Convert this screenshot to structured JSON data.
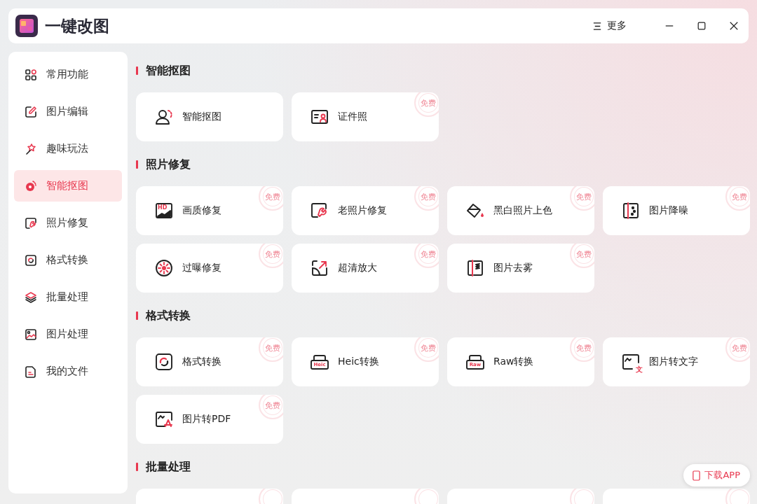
{
  "app": {
    "title": "一键改图",
    "more": "更多"
  },
  "sidebar": [
    {
      "label": "常用功能",
      "selected": false
    },
    {
      "label": "图片编辑",
      "selected": false
    },
    {
      "label": "趣味玩法",
      "selected": false
    },
    {
      "label": "智能抠图",
      "selected": true
    },
    {
      "label": "照片修复",
      "selected": false
    },
    {
      "label": "格式转换",
      "selected": false
    },
    {
      "label": "批量处理",
      "selected": false
    },
    {
      "label": "图片处理",
      "selected": false
    },
    {
      "label": "我的文件",
      "selected": false
    }
  ],
  "sections": [
    {
      "title": "智能抠图",
      "cards": [
        {
          "label": "智能抠图"
        },
        {
          "label": "证件照",
          "badge": "免费"
        }
      ]
    },
    {
      "title": "照片修复",
      "cards": [
        {
          "label": "画质修复",
          "badge": "免费",
          "tag": "HD"
        },
        {
          "label": "老照片修复",
          "badge": "免费"
        },
        {
          "label": "黑白照片上色",
          "badge": "免费"
        },
        {
          "label": "图片降噪",
          "badge": "免费"
        },
        {
          "label": "过曝修复",
          "badge": "免费"
        },
        {
          "label": "超清放大",
          "badge": "免费"
        },
        {
          "label": "图片去雾",
          "badge": "免费"
        }
      ]
    },
    {
      "title": "格式转换",
      "cards": [
        {
          "label": "格式转换",
          "badge": "免费"
        },
        {
          "label": "Heic转换",
          "badge": "免费",
          "tag": "Heic"
        },
        {
          "label": "Raw转换",
          "badge": "免费",
          "tag": "Raw"
        },
        {
          "label": "图片转文字",
          "badge": "免费",
          "tag": "文"
        },
        {
          "label": "图片转PDF",
          "badge": "免费"
        }
      ]
    },
    {
      "title": "批量处理",
      "cards": [
        {
          "stamp": true
        },
        {
          "stamp": true
        },
        {
          "stamp": true
        },
        {
          "stamp": true
        }
      ]
    }
  ],
  "download": "下载APP"
}
